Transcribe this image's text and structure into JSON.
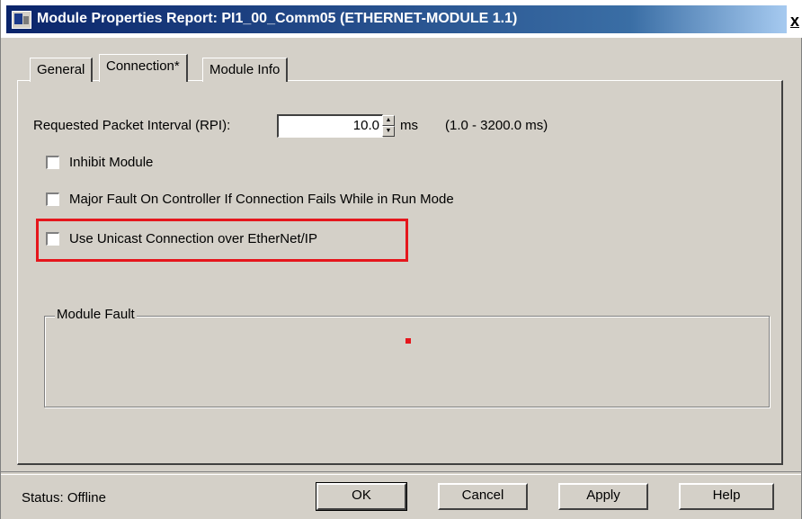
{
  "window": {
    "title": "Module Properties Report: PI1_00_Comm05 (ETHERNET-MODULE 1.1)",
    "close_symbol": "x",
    "icon": "module-properties-icon"
  },
  "tabs": [
    {
      "label": "General",
      "active": false
    },
    {
      "label": "Connection*",
      "active": true
    },
    {
      "label": "Module Info",
      "active": false
    }
  ],
  "connection": {
    "rpi_label": "Requested Packet Interval (RPI):",
    "rpi_value": "10.0",
    "rpi_unit": "ms",
    "rpi_range": "(1.0 - 3200.0 ms)",
    "options": [
      {
        "label": "Inhibit Module",
        "checked": false
      },
      {
        "label": "Major Fault On Controller If Connection Fails While in Run Mode",
        "checked": false
      },
      {
        "label": "Use Unicast Connection over EtherNet/IP",
        "checked": false,
        "highlighted": true
      }
    ],
    "module_fault_label": "Module Fault"
  },
  "status": {
    "text": "Status:  Offline"
  },
  "buttons": {
    "ok": "OK",
    "cancel": "Cancel",
    "apply": "Apply",
    "help": "Help"
  },
  "colors": {
    "title_bar_start": "#0a246a",
    "title_bar_end": "#a6caf0",
    "highlight": "#e5161c",
    "face": "#d4d0c8"
  }
}
